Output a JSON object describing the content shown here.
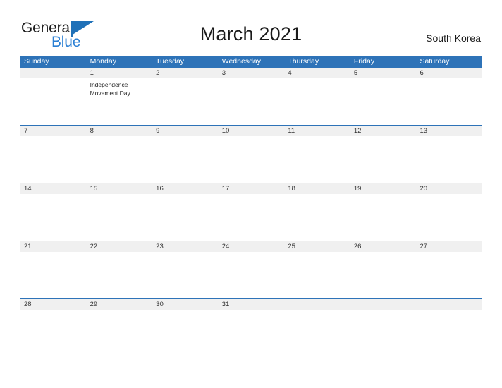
{
  "brand": {
    "name_part1": "General",
    "name_part2": "Blue",
    "flag_icon": "blue-flag-icon",
    "color_primary": "#2a7fd4",
    "color_text": "#1a1a1a"
  },
  "header": {
    "title": "March 2021",
    "region": "South Korea"
  },
  "calendar": {
    "header_color": "#2e73b8",
    "band_color": "#f0f0f0",
    "weekdays": [
      "Sunday",
      "Monday",
      "Tuesday",
      "Wednesday",
      "Thursday",
      "Friday",
      "Saturday"
    ],
    "weeks": [
      {
        "days": [
          {
            "num": "",
            "event": ""
          },
          {
            "num": "1",
            "event": "Independence Movement Day"
          },
          {
            "num": "2",
            "event": ""
          },
          {
            "num": "3",
            "event": ""
          },
          {
            "num": "4",
            "event": ""
          },
          {
            "num": "5",
            "event": ""
          },
          {
            "num": "6",
            "event": ""
          }
        ]
      },
      {
        "days": [
          {
            "num": "7",
            "event": ""
          },
          {
            "num": "8",
            "event": ""
          },
          {
            "num": "9",
            "event": ""
          },
          {
            "num": "10",
            "event": ""
          },
          {
            "num": "11",
            "event": ""
          },
          {
            "num": "12",
            "event": ""
          },
          {
            "num": "13",
            "event": ""
          }
        ]
      },
      {
        "days": [
          {
            "num": "14",
            "event": ""
          },
          {
            "num": "15",
            "event": ""
          },
          {
            "num": "16",
            "event": ""
          },
          {
            "num": "17",
            "event": ""
          },
          {
            "num": "18",
            "event": ""
          },
          {
            "num": "19",
            "event": ""
          },
          {
            "num": "20",
            "event": ""
          }
        ]
      },
      {
        "days": [
          {
            "num": "21",
            "event": ""
          },
          {
            "num": "22",
            "event": ""
          },
          {
            "num": "23",
            "event": ""
          },
          {
            "num": "24",
            "event": ""
          },
          {
            "num": "25",
            "event": ""
          },
          {
            "num": "26",
            "event": ""
          },
          {
            "num": "27",
            "event": ""
          }
        ]
      },
      {
        "days": [
          {
            "num": "28",
            "event": ""
          },
          {
            "num": "29",
            "event": ""
          },
          {
            "num": "30",
            "event": ""
          },
          {
            "num": "31",
            "event": ""
          },
          {
            "num": "",
            "event": ""
          },
          {
            "num": "",
            "event": ""
          },
          {
            "num": "",
            "event": ""
          }
        ]
      }
    ]
  }
}
